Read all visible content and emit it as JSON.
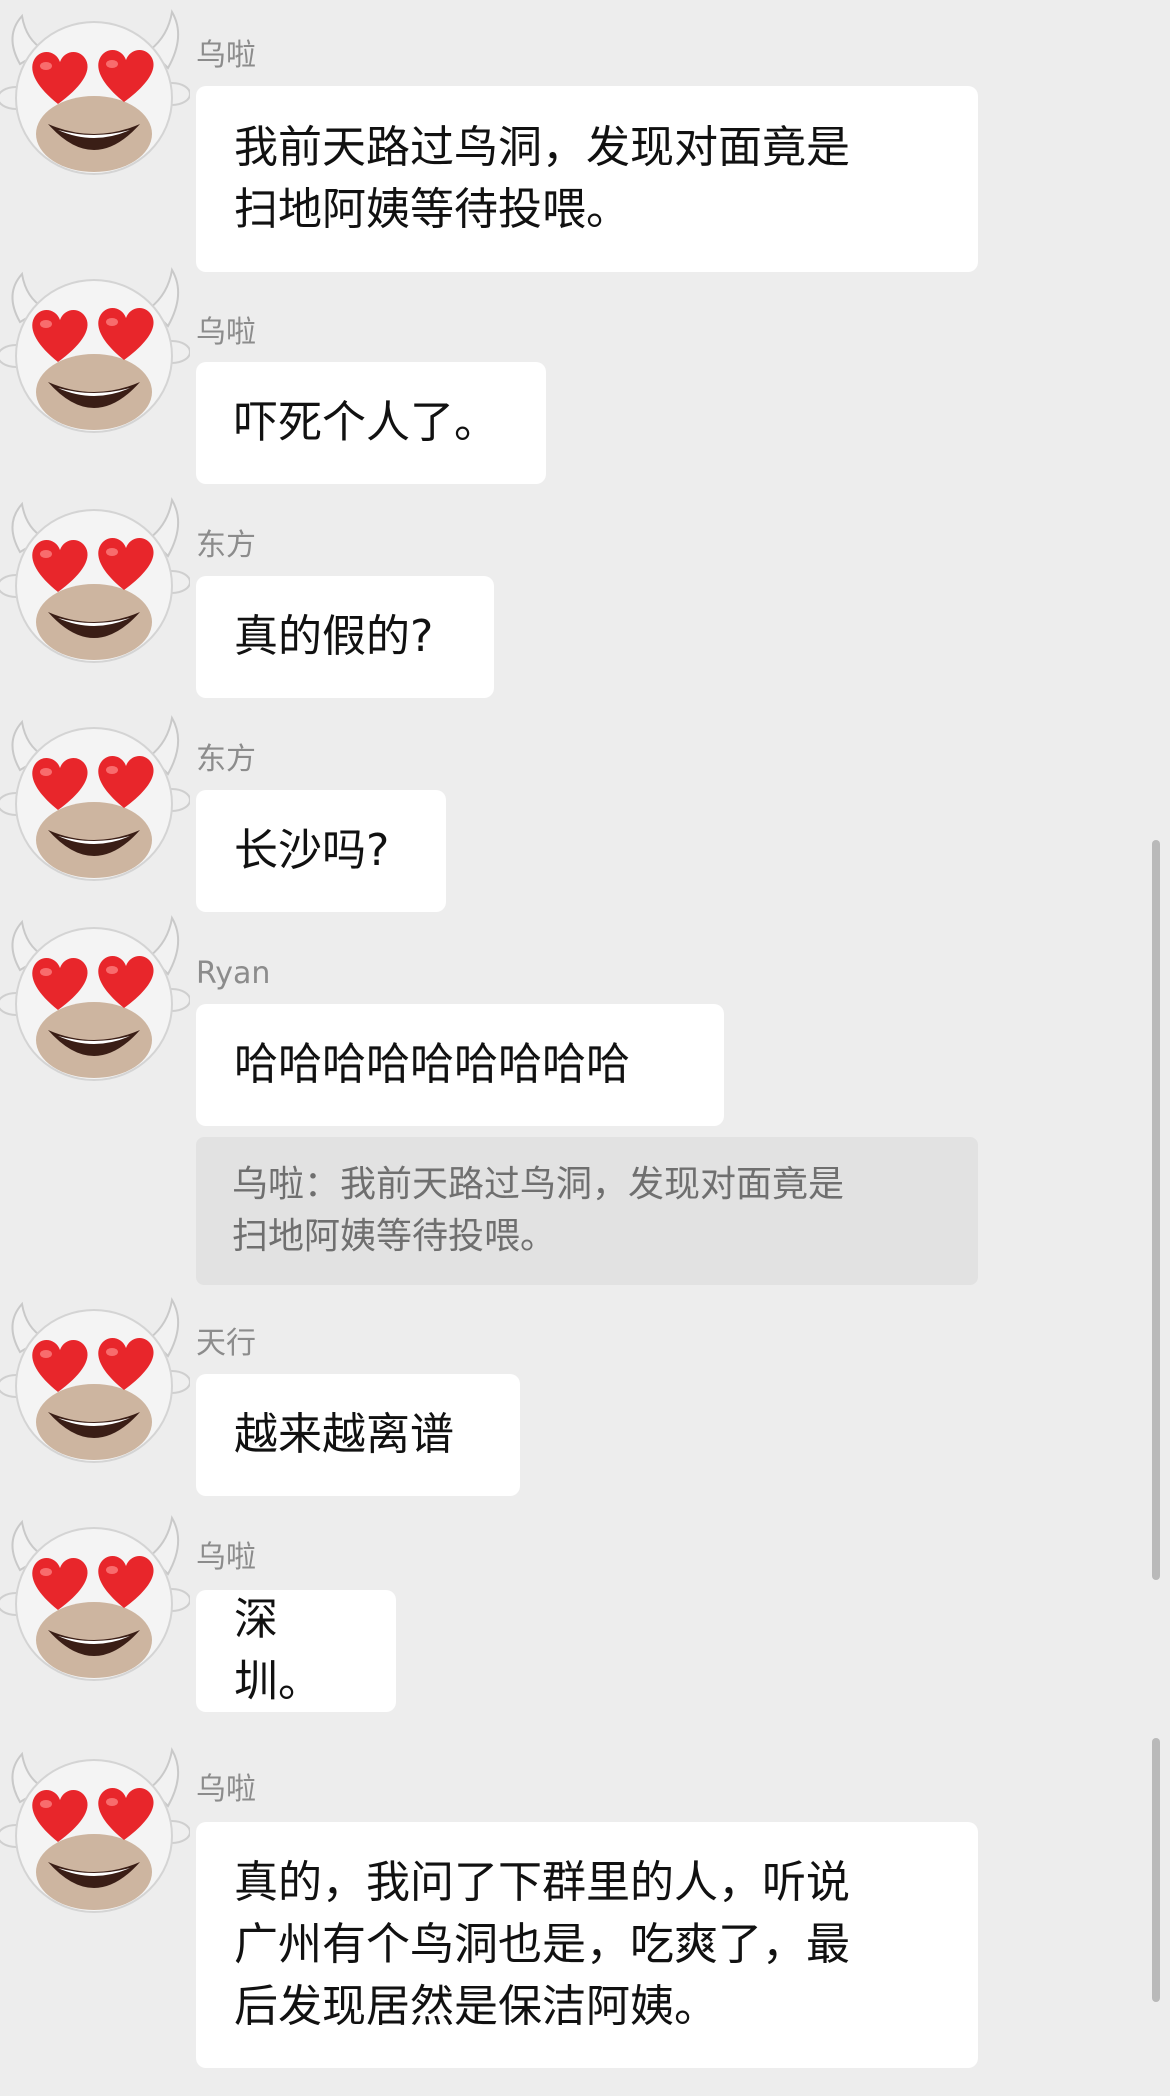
{
  "messages": [
    {
      "sender": "乌啦",
      "text": "我前天路过鸟洞，发现对面竟是\n扫地阿姨等待投喂。",
      "avatar": "heart-eyes-cow-avatar"
    },
    {
      "sender": "乌啦",
      "text": "吓死个人了。",
      "avatar": "heart-eyes-cow-avatar"
    },
    {
      "sender": "东方",
      "text": "真的假的?",
      "avatar": "heart-eyes-cow-avatar"
    },
    {
      "sender": "东方",
      "text": "长沙吗?",
      "avatar": "heart-eyes-cow-avatar"
    },
    {
      "sender": "Ryan",
      "text": "哈哈哈哈哈哈哈哈哈",
      "avatar": "heart-eyes-cow-avatar"
    },
    {
      "sender": "天行",
      "text": "越来越离谱",
      "avatar": "heart-eyes-cow-avatar"
    },
    {
      "sender": "乌啦",
      "text": "深圳。",
      "avatar": "heart-eyes-cow-avatar"
    },
    {
      "sender": "乌啦",
      "text": "真的，我问了下群里的人，听说\n广州有个鸟洞也是，吃爽了，最\n后发现居然是保洁阿姨。",
      "avatar": "heart-eyes-cow-avatar"
    }
  ],
  "quote": {
    "text": "乌啦：我前天路过鸟洞，发现对面竟是\n扫地阿姨等待投喂。"
  },
  "colors": {
    "background": "#ededed",
    "bubble": "#ffffff",
    "quote": "#e2e2e2",
    "sender": "#8c8c8c",
    "heart": "#e8262b"
  }
}
